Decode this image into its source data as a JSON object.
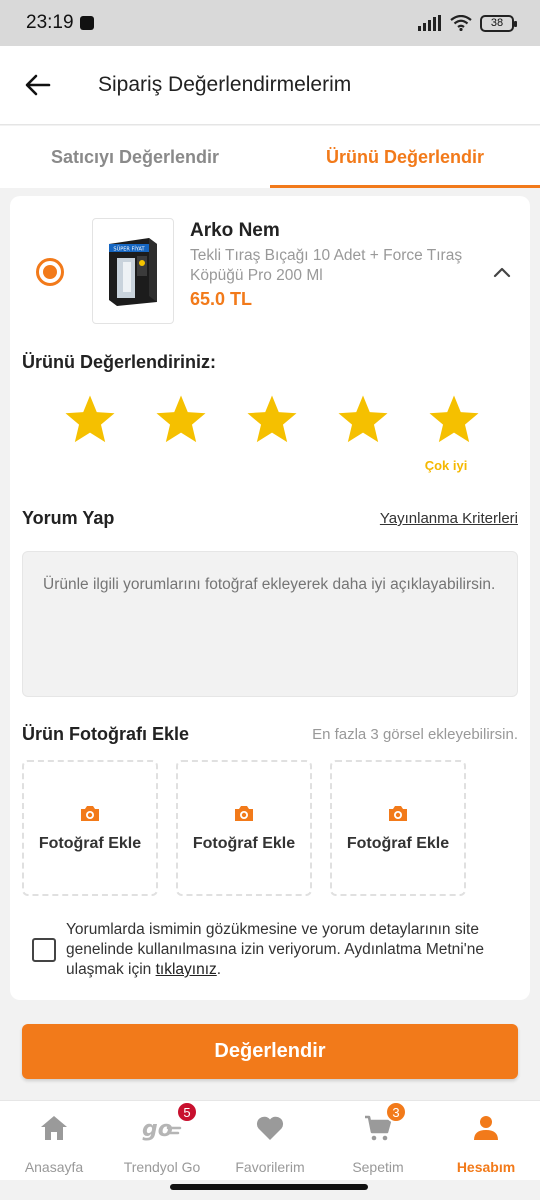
{
  "status_bar": {
    "time": "23:19",
    "battery": "38"
  },
  "header": {
    "title": "Sipariş Değerlendirmelerim"
  },
  "tabs": [
    {
      "label": "Satıcıyı Değerlendir",
      "active": false
    },
    {
      "label": "Ürünü Değerlendir",
      "active": true
    }
  ],
  "product": {
    "brand": "Arko Nem",
    "name": "Tekli Tıraş Bıçağı 10 Adet + Force Tıraş Köpüğü Pro 200 Ml",
    "price": "65.0 TL",
    "thumb_badge": "SÜPER FİYAT"
  },
  "rating": {
    "title": "Ürünü Değerlendiriniz:",
    "value": 5,
    "max": 5,
    "label": "Çok iyi",
    "star_color": "#f5c000"
  },
  "comment": {
    "title": "Yorum Yap",
    "criteria_link": "Yayınlanma Kriterleri",
    "placeholder": "Ürünle ilgili yorumlarını fotoğraf ekleyerek daha iyi açıklayabilirsin.",
    "value": ""
  },
  "photos": {
    "title": "Ürün Fotoğrafı Ekle",
    "hint": "En fazla 3 görsel ekleyebilirsin.",
    "slot_label": "Fotoğraf Ekle"
  },
  "consent": {
    "text_before": "Yorumlarda ismimin gözükmesine ve yorum detaylarının site genelinde kullanılmasına izin veriyorum. Aydınlatma Metni'ne ulaşmak için ",
    "link": "tıklayınız",
    "text_after": ".",
    "checked": false
  },
  "actions": {
    "submit": "Değerlendir"
  },
  "bottom_nav": [
    {
      "label": "Anasayfa",
      "icon": "home-icon",
      "badge": ""
    },
    {
      "label": "Trendyol Go",
      "icon": "trendyol-go-icon",
      "badge": "5"
    },
    {
      "label": "Favorilerim",
      "icon": "heart-icon",
      "badge": ""
    },
    {
      "label": "Sepetim",
      "icon": "cart-icon",
      "badge": "3"
    },
    {
      "label": "Hesabım",
      "icon": "user-icon",
      "badge": "",
      "active": true
    }
  ],
  "colors": {
    "accent": "#f27a1a",
    "star": "#f5c000",
    "badge_red": "#c8102e"
  }
}
